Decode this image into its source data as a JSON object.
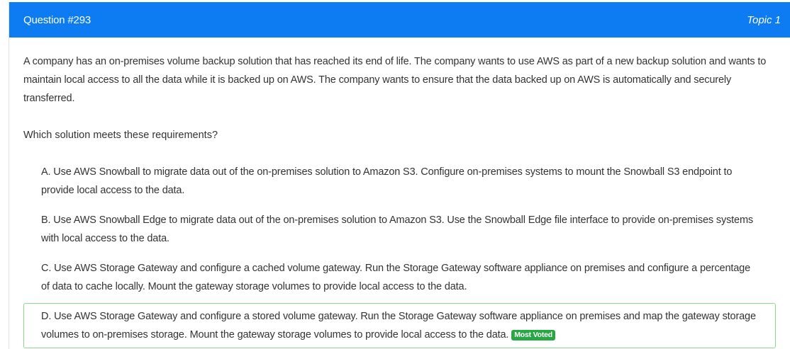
{
  "header": {
    "question_number": "Question #293",
    "topic": "Topic 1"
  },
  "question": {
    "text": "A company has an on-premises volume backup solution that has reached its end of life. The company wants to use AWS as part of a new backup solution and wants to maintain local access to all the data while it is backed up on AWS. The company wants to ensure that the data backed up on AWS is automatically and securely transferred.",
    "prompt": "Which solution meets these requirements?"
  },
  "choices": [
    {
      "letter": "A.",
      "text": "Use AWS Snowball to migrate data out of the on-premises solution to Amazon S3. Configure on-premises systems to mount the Snowball S3 endpoint to provide local access to the data."
    },
    {
      "letter": "B.",
      "text": "Use AWS Snowball Edge to migrate data out of the on-premises solution to Amazon S3. Use the Snowball Edge file interface to provide on-premises systems with local access to the data."
    },
    {
      "letter": "C.",
      "text": "Use AWS Storage Gateway and configure a cached volume gateway. Run the Storage Gateway software appliance on premises and configure a percentage of data to cache locally. Mount the gateway storage volumes to provide local access to the data."
    },
    {
      "letter": "D.",
      "text": "Use AWS Storage Gateway and configure a stored volume gateway. Run the Storage Gateway software appliance on premises and map the gateway storage volumes to on-premises storage. Mount the gateway storage volumes to provide local access to the data.",
      "badge": "Most Voted"
    }
  ],
  "colors": {
    "header_bg": "#0d7cf2",
    "correct_border": "#8cd98c",
    "badge_bg": "#28a745"
  }
}
